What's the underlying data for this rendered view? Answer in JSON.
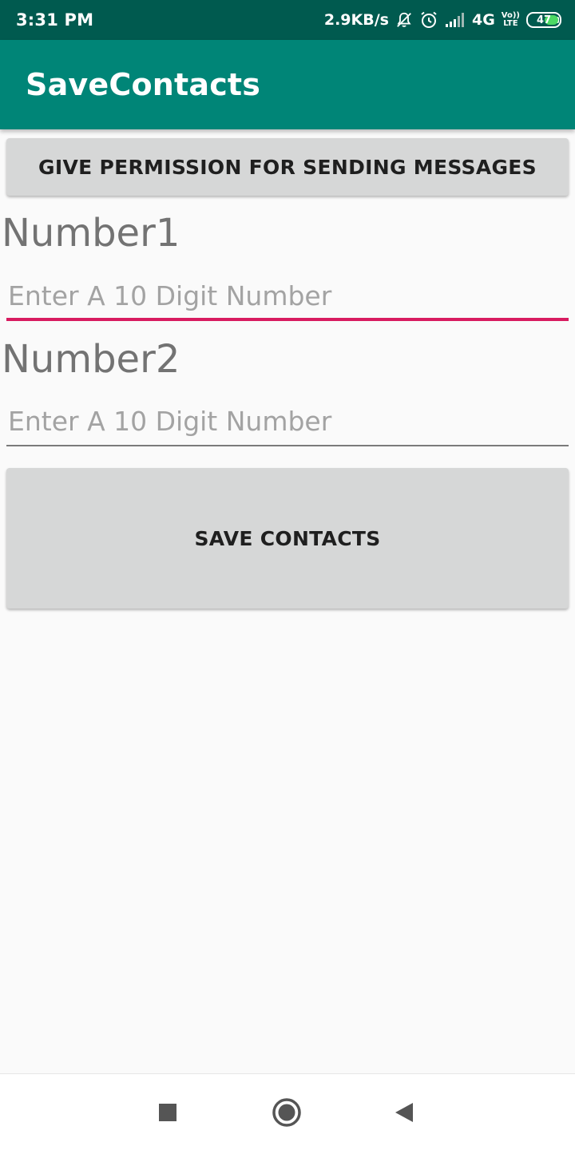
{
  "status_bar": {
    "time": "3:31 PM",
    "net_speed": "2.9KB/s",
    "network_type": "4G",
    "volte_top": "Vo))",
    "volte_bottom": "LTE",
    "battery_level": "47",
    "battery_fraction": 0.47,
    "icons": [
      "notifications-muted-icon",
      "alarm-icon",
      "signal-icon",
      "volte-icon",
      "battery-icon"
    ],
    "background_color": "#005a4f"
  },
  "app_bar": {
    "title": "SaveContacts",
    "background_color": "#008577"
  },
  "permission_button": {
    "label": "GIVE PERMISSION FOR SENDING MESSAGES"
  },
  "number1": {
    "label": "Number1",
    "placeholder": "Enter A 10 Digit Number",
    "value": "",
    "focused": true
  },
  "number2": {
    "label": "Number2",
    "placeholder": "Enter A 10 Digit Number",
    "value": ""
  },
  "save_button": {
    "label": "SAVE CONTACTS"
  },
  "nav_bar": {
    "icons": [
      "recent-apps-icon",
      "home-icon",
      "back-icon"
    ]
  },
  "colors": {
    "accent": "#d81b60",
    "button": "#d6d7d7",
    "background": "#fafafa"
  }
}
